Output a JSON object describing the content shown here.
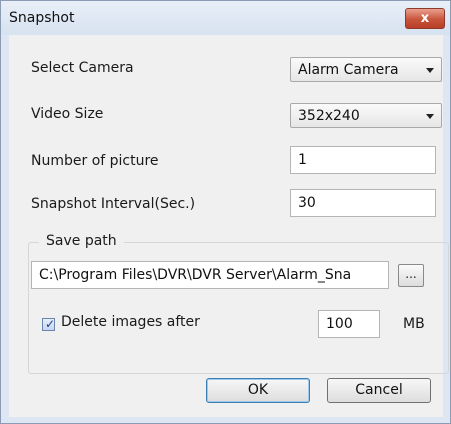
{
  "window": {
    "title": "Snapshot",
    "close_glyph": "x"
  },
  "form": {
    "select_camera_label": "Select Camera",
    "select_camera_value": "Alarm Camera",
    "video_size_label": "Video Size",
    "video_size_value": "352x240",
    "num_pictures_label": "Number of picture",
    "num_pictures_value": "1",
    "interval_label": "Snapshot Interval(Sec.)",
    "interval_value": "30"
  },
  "save_path": {
    "group_title": "Save path",
    "path_value": "C:\\Program Files\\DVR\\DVR Server\\Alarm_Sna",
    "browse_label": "...",
    "delete_label": "Delete images after",
    "delete_checked": true,
    "size_value": "100",
    "size_unit": "MB"
  },
  "buttons": {
    "ok": "OK",
    "cancel": "Cancel"
  },
  "colors": {
    "close_button": "#c9543c",
    "window_frame": "#dde6f2",
    "client_bg": "#f0f0f0"
  }
}
